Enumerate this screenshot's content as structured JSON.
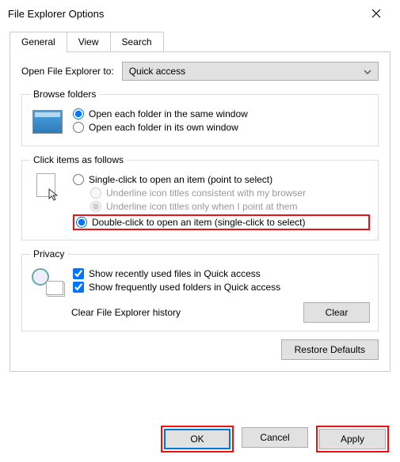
{
  "title": "File Explorer Options",
  "tabs": {
    "general": "General",
    "view": "View",
    "search": "Search"
  },
  "openTo": {
    "label": "Open File Explorer to:",
    "value": "Quick access"
  },
  "browse": {
    "legend": "Browse folders",
    "same": "Open each folder in the same window",
    "own": "Open each folder in its own window"
  },
  "click": {
    "legend": "Click items as follows",
    "single": "Single-click to open an item (point to select)",
    "u1": "Underline icon titles consistent with my browser",
    "u2": "Underline icon titles only when I point at them",
    "double": "Double-click to open an item (single-click to select)"
  },
  "privacy": {
    "legend": "Privacy",
    "recent": "Show recently used files in Quick access",
    "freq": "Show frequently used folders in Quick access",
    "clearLabel": "Clear File Explorer history",
    "clearBtn": "Clear"
  },
  "restore": "Restore Defaults",
  "buttons": {
    "ok": "OK",
    "cancel": "Cancel",
    "apply": "Apply"
  }
}
